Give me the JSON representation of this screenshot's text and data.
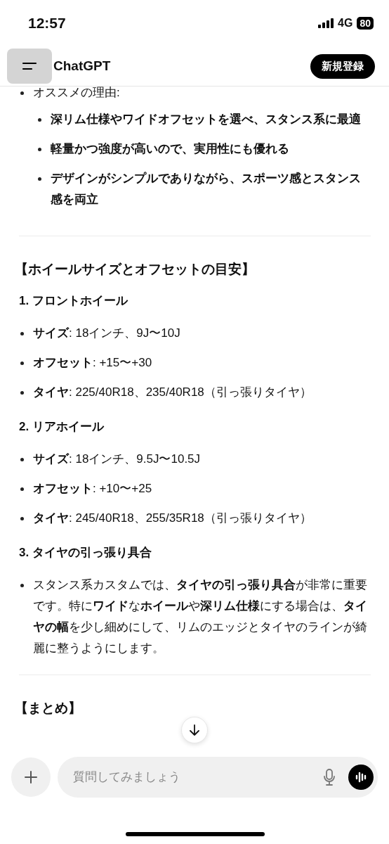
{
  "status_bar": {
    "time": "12:57",
    "network": "4G",
    "battery": "80"
  },
  "header": {
    "title": "ChatGPT",
    "signup_button": "新規登録"
  },
  "sections": [
    {
      "blocks": [
        {
          "kind": "bullet",
          "text": "オススメの理由:"
        },
        {
          "kind": "sub_bullet",
          "text": "**深リム仕様**や**ワイドオフセット**を選べ、スタンス系に最適"
        },
        {
          "kind": "sub_bullet",
          "text": "**軽量かつ強度が高い**ので、実用性にも優れる"
        },
        {
          "kind": "sub_bullet",
          "text": "デザインがシンプルでありながら、スポーツ感とスタンス感を両立"
        }
      ]
    },
    {
      "blocks": [
        {
          "kind": "heading",
          "text": "【ホイールサイズとオフセットの目安】"
        },
        {
          "kind": "subheading",
          "text": "1. フロントホイール"
        },
        {
          "kind": "bullet",
          "text": "**サイズ**: 18インチ、9J〜10J"
        },
        {
          "kind": "bullet",
          "text": "**オフセット**: +15〜+30"
        },
        {
          "kind": "bullet",
          "text": "**タイヤ**: 225/40R18、235/40R18（引っ張りタイヤ）"
        },
        {
          "kind": "subheading",
          "text": "2. リアホイール"
        },
        {
          "kind": "bullet",
          "text": "**サイズ**: 18インチ、9.5J〜10.5J"
        },
        {
          "kind": "bullet",
          "text": "**オフセット**: +10〜+25"
        },
        {
          "kind": "bullet",
          "text": "**タイヤ**: 245/40R18、255/35R18（引っ張りタイヤ）"
        },
        {
          "kind": "subheading",
          "text": "3. タイヤの引っ張り具合"
        },
        {
          "kind": "bullet",
          "text": "スタンス系カスタムでは、**タイヤの引っ張り具合**が非常に重要です。特に**ワイド**な**ホイール**や**深リム仕様**にする場合は、**タイヤの幅**を少し細めにして、リムのエッジとタイヤのラインが綺麗に整うようにします。"
        }
      ]
    },
    {
      "blocks": [
        {
          "kind": "heading",
          "text": "【まとめ】"
        }
      ]
    }
  ],
  "composer": {
    "placeholder": "質問してみましょう"
  }
}
